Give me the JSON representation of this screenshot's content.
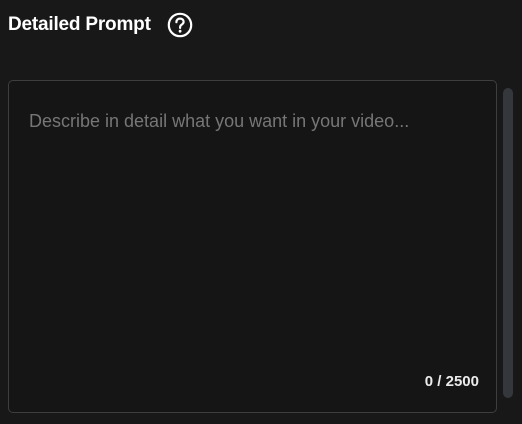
{
  "header": {
    "title": "Detailed Prompt",
    "help_icon": "question-circle-icon"
  },
  "prompt": {
    "value": "",
    "placeholder": "Describe in detail what you want in your video...",
    "counter": "0 / 2500",
    "char_count": 0,
    "char_limit": 2500
  },
  "colors": {
    "background": "#181818",
    "field_background": "#151515",
    "field_border": "#3e3e3e",
    "placeholder": "#767676",
    "text": "#ffffff",
    "scrollbar_thumb": "#34373c"
  }
}
